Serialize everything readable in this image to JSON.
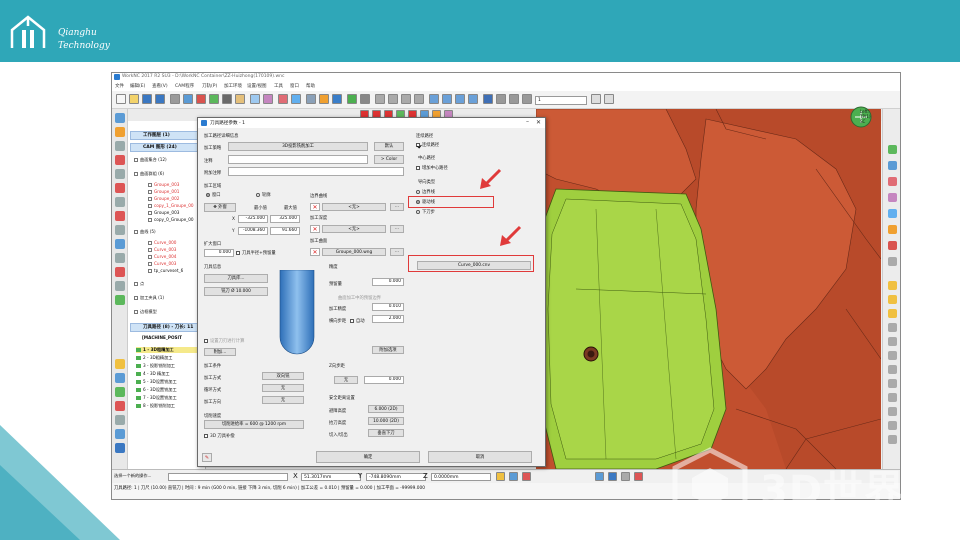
{
  "slide": {
    "logo_line1": "Qianghu",
    "logo_line2": "Technology",
    "watermark_brand": "3D世界网",
    "watermark_url": "WWW.3DSJW.COM",
    "watermark_company": "HEXAGON"
  },
  "app": {
    "title": "WorkNC 2017 R2 SU3 - D:\\WorkNC Container\\ZZ-Huizhong(170109).wnc",
    "menu": [
      "文件",
      "编辑(E)",
      "查看(V)",
      "CAM程序",
      "刀轨(P)",
      "加工环境",
      "设置/视图",
      "工具",
      "窗口",
      "帮助"
    ],
    "zoom_value": "1",
    "tree": {
      "head1": "工作图层 (1)",
      "head2": "CAM 图形 (24)",
      "items": [
        "曲面集合 (12)",
        "曲面群组 (6)",
        "Groupe_003",
        "Groupe_001",
        "Groupe_002",
        "copy_1_Groupe_00",
        "Groupe_003",
        "copy_0_Groupe_00",
        "曲线 (5)",
        "Curve_000",
        "Curve_003",
        "Curve_004",
        "Curve_003",
        "tp_curveset_6",
        "点",
        "加工夹具 (1)",
        "边框模型",
        "刀具路径 (8) - 刀长: 11",
        "[MACHINE_POSIT",
        "1 - 3D粗精加工",
        "2 - 3D粗精加工",
        "3 - 投影铣削加工",
        "4 - 3D 精加工",
        "5 - 3D设置铣加工",
        "6 - 3D设置铣加工",
        "7 - 3D设置铣加工",
        "8 - 投影铣削加工"
      ]
    },
    "view_info": [
      "Left:",
      "TP(1)",
      "SC"
    ],
    "status": {
      "select_label": "选择一个新的操作...",
      "x_label": "X",
      "x_value": "51.3017mm",
      "y_label": "Y",
      "y_value": "-748.8090mm",
      "z_label": "Z",
      "z_value": "0.0000mm",
      "line": "刀具路径: 1 | 刀尺 (10.00) 直铣刀 | 时间 : 9 min (G00 0 min, 链接 下降 3 min, 切削 6 min) | 加工公差 = 0.010 | 预留量 = 0.000 | 加工平面 = -99999.000"
    }
  },
  "dialog": {
    "title": "刀具路径参数 - 1",
    "general_section": "加工路径详细信息",
    "strategy_label": "加工策略",
    "strategy_value": "3D投影铣削加工",
    "default_btn": "默认",
    "comment_label": "注释",
    "color_btn": "> Color",
    "extra_comment_label": "附加注释",
    "area_section": "加工区域",
    "radio_window": "窗口",
    "radio_contour": "轮廓",
    "edit_btn": "✥ 外窗",
    "min_label": "最小值",
    "max_label": "最大值",
    "x_label": "X",
    "x_min": "-325.000",
    "x_max": "325.000",
    "y_label": "Y",
    "y_min": "-1008.360",
    "y_max": "91.660",
    "expand_label": "扩大窗口",
    "expand_value": "0.000",
    "expand_check": "刀具半径+预留量",
    "boundary_section": "边界曲线",
    "boundary_value": "<无>",
    "depth_section": "加工深度",
    "depth_value": "<无>",
    "surface_section": "加工曲面",
    "surface_value": "Groupe_000.wng",
    "tool_section": "刀具信息",
    "tool_library_btn": "刀具库...",
    "tool_name_btn": "铣刀 Ø 10.000",
    "attach_note": "设置刀刃进行计算",
    "attach_btn": "附加...",
    "params_section": "精度",
    "allowance_label": "预留量",
    "allowance_value": "0.000",
    "geom_hint": "曲面加工中的预留边界",
    "tolerance_label": "加工精度",
    "tolerance_value": "0.010",
    "stepover_label": "横向步距",
    "stepover_check": "自动",
    "stepover_value": "2.000",
    "advanced_btn": "附加选项",
    "machining_section": "加工条件",
    "mach_type_label": "加工方式",
    "mach_type_btn": "双向铣",
    "cut_mode_label": "循环方式",
    "cut_mode_btn": "无",
    "direction_label": "加工方向",
    "direction_btn": "无",
    "feed_section": "切削速度",
    "feed_btn": "切削进给率 = 600 @ 1200 rpm",
    "feed_check": "3D 刀具补偿",
    "zstep_section": "Z向步距",
    "zstep_btn": "无",
    "zstep_value": "0.000",
    "safety_section": "安全距离设置",
    "safe_plane_label": "避障高度",
    "safe_plane_value": "6.000 (2D)",
    "retract_label": "抬刀高度",
    "retract_value": "10.000 (2D)",
    "linking_label": "切入/切出",
    "linking_btn": "垂直下刀",
    "path_section": "连续路径",
    "path_check": "连续路径",
    "center_section": "中心路径",
    "center_check": "增加中心路径",
    "guide_section": "导向类型",
    "guide_radio1": "边界线",
    "guide_radio2": "驱动线",
    "guide_radio3": "下刀步",
    "guide_curve_btn": "Curve_000.cnv",
    "ok_btn": "确定",
    "cancel_btn": "取消"
  },
  "colors": {
    "header": "#2fa7b8",
    "viewport_bg": "#c14f2e",
    "part_green": "#9fcf3f",
    "highlight": "#e03a3a"
  }
}
